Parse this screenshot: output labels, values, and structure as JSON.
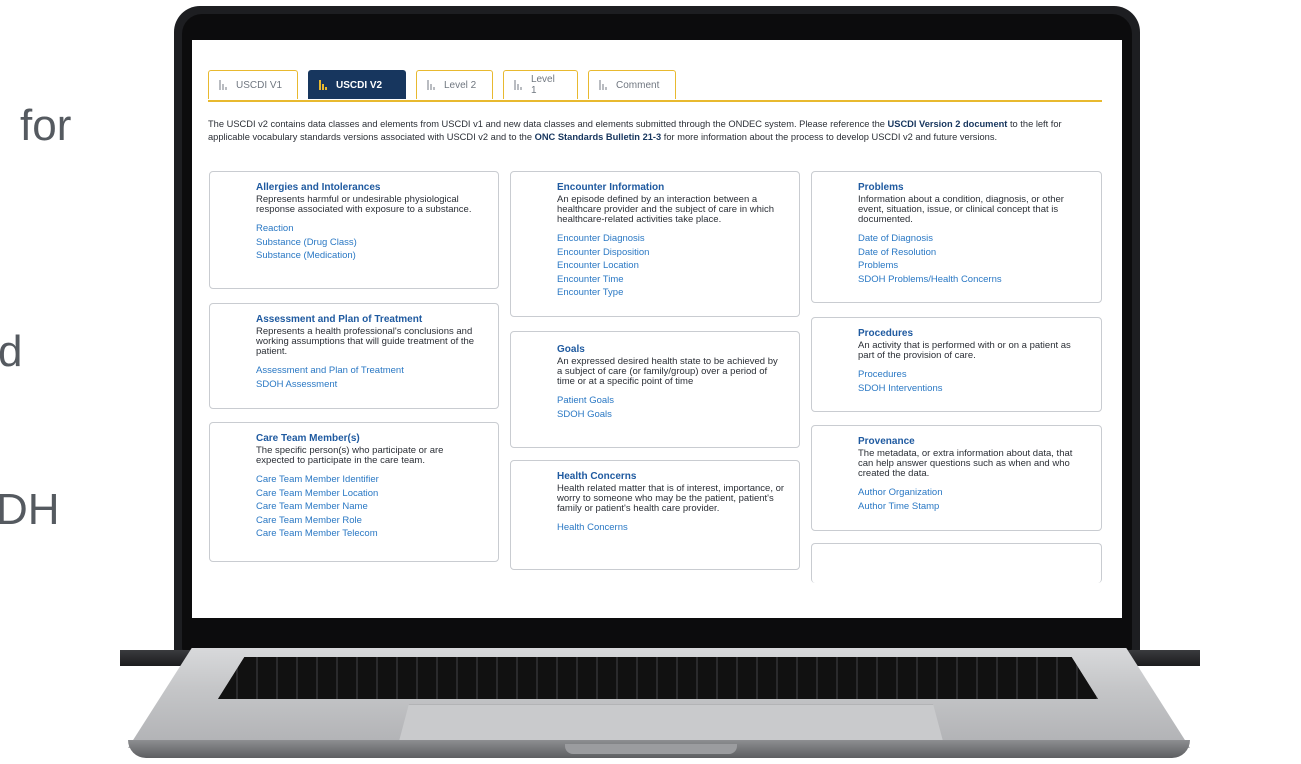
{
  "side_text": [
    "for",
    "d",
    "DH"
  ],
  "tabs": [
    {
      "label": "USCDI V1",
      "active": false
    },
    {
      "label": "USCDI V2",
      "active": true
    },
    {
      "label": "Level 2",
      "active": false
    },
    {
      "label": "Level 1",
      "active": false
    },
    {
      "label": "Comment",
      "active": false
    }
  ],
  "intro": {
    "part1": "The USCDI v2 contains data classes and elements from USCDI v1 and new data classes and elements submitted through the ONDEC system. Please reference the ",
    "link1": "USCDI Version 2 document",
    "part2": " to the left for applicable vocabulary standards versions associated with USCDI v2 and to the ",
    "link2": "ONC Standards Bulletin 21-3",
    "part3": " for more information about the process to develop USCDI v2 and future versions."
  },
  "cards": [
    {
      "title": "Allergies and Intolerances",
      "desc": "Represents harmful or undesirable physiological response associated with exposure to a substance.",
      "items": [
        "Reaction",
        "Substance (Drug Class)",
        "Substance (Medication)"
      ]
    },
    {
      "title": "Assessment and Plan of Treatment",
      "desc": "Represents a health professional's conclusions and working assumptions that will guide treatment of the patient.",
      "items": [
        "Assessment and Plan of Treatment",
        "SDOH Assessment"
      ]
    },
    {
      "title": "Care Team Member(s)",
      "desc": "The specific person(s) who participate or are expected to participate in the care team.",
      "items": [
        "Care Team Member Identifier",
        "Care Team Member Location",
        "Care Team Member Name",
        "Care Team Member Role",
        "Care Team Member Telecom"
      ]
    },
    {
      "title": "Encounter Information",
      "desc": "An episode defined by an interaction between a healthcare provider and the subject of care in which healthcare-related activities take place.",
      "items": [
        "Encounter Diagnosis",
        "Encounter Disposition",
        "Encounter Location",
        "Encounter Time",
        "Encounter Type"
      ]
    },
    {
      "title": "Goals",
      "desc": "An expressed desired health state to be achieved by a subject of care (or family/group) over a period of time or at a specific point of time",
      "items": [
        "Patient Goals",
        "SDOH Goals"
      ]
    },
    {
      "title": "Health Concerns",
      "desc": "Health related matter that is of interest, importance, or worry to someone who may be the patient, patient's family or patient's health care provider.",
      "items": [
        "Health Concerns"
      ]
    },
    {
      "title": "Problems",
      "desc": "Information about a condition, diagnosis, or other event, situation, issue, or clinical concept that is documented.",
      "items": [
        "Date of Diagnosis",
        "Date of Resolution",
        "Problems",
        "SDOH Problems/Health Concerns"
      ]
    },
    {
      "title": "Procedures",
      "desc": "An activity that is performed with or on a patient as part of the provision of care.",
      "items": [
        "Procedures",
        "SDOH Interventions"
      ]
    },
    {
      "title": "Provenance",
      "desc": "The metadata, or extra information about data, that can help answer questions such as when and who created the data.",
      "items": [
        "Author Organization",
        "Author Time Stamp"
      ]
    }
  ],
  "colors": {
    "accent": "#e8b92f",
    "tab_active": "#17365e",
    "link": "#2a78c4",
    "title": "#1f5aa0"
  }
}
